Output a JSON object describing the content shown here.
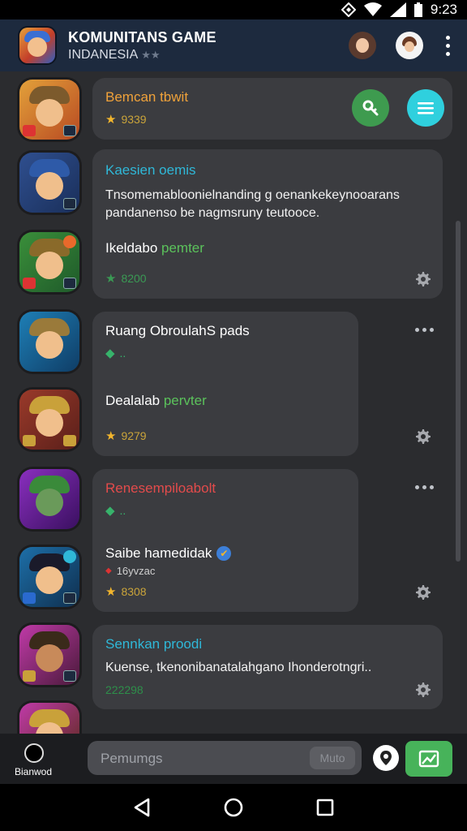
{
  "status": {
    "time": "9:23"
  },
  "header": {
    "title": "KOMUNITANS GAME",
    "subtitle": "INDANESIA",
    "subtitle_stars": "★★"
  },
  "cards": [
    {
      "title": "Bemcan tbwit",
      "title_color": "#f0a23a",
      "rating": "9339"
    },
    {
      "title": "Kaesien oemis",
      "title_color": "#2fb8d8",
      "body": "Tnsomemabloonielnanding g oenankekeynooarans pandanenso be nagmsruny teutooce.",
      "subtitle": "Ikeldabo",
      "subtitle_tail": "pemter",
      "rating": "8200"
    },
    {
      "title": "Ruang ObroulahS pads",
      "title_color": "#ffffff",
      "gem_mark": "..",
      "subtitle": "Dealalab",
      "subtitle_tail": "pervter",
      "rating": "9279"
    },
    {
      "title": "Renesempiloabolt",
      "title_color": "#e34b4b",
      "gem_mark": "..",
      "subtitle": "Saibe hamedidak",
      "note": "16yvzac",
      "rating": "8308"
    },
    {
      "title": "Sennkan proodi",
      "title_color": "#2fb8d8",
      "body": "Kuense, tkenonibanatalahgano Ihonderotngri..",
      "rating": "222298"
    }
  ],
  "composer": {
    "user_label": "Bianwod",
    "placeholder": "Pemumgs",
    "inner_button": "Muto"
  },
  "colors": {
    "header_bg": "#1d2a3e",
    "card_bg": "#3b3c40",
    "accent_green": "#47b35a",
    "accent_cyan": "#2fd0de"
  }
}
